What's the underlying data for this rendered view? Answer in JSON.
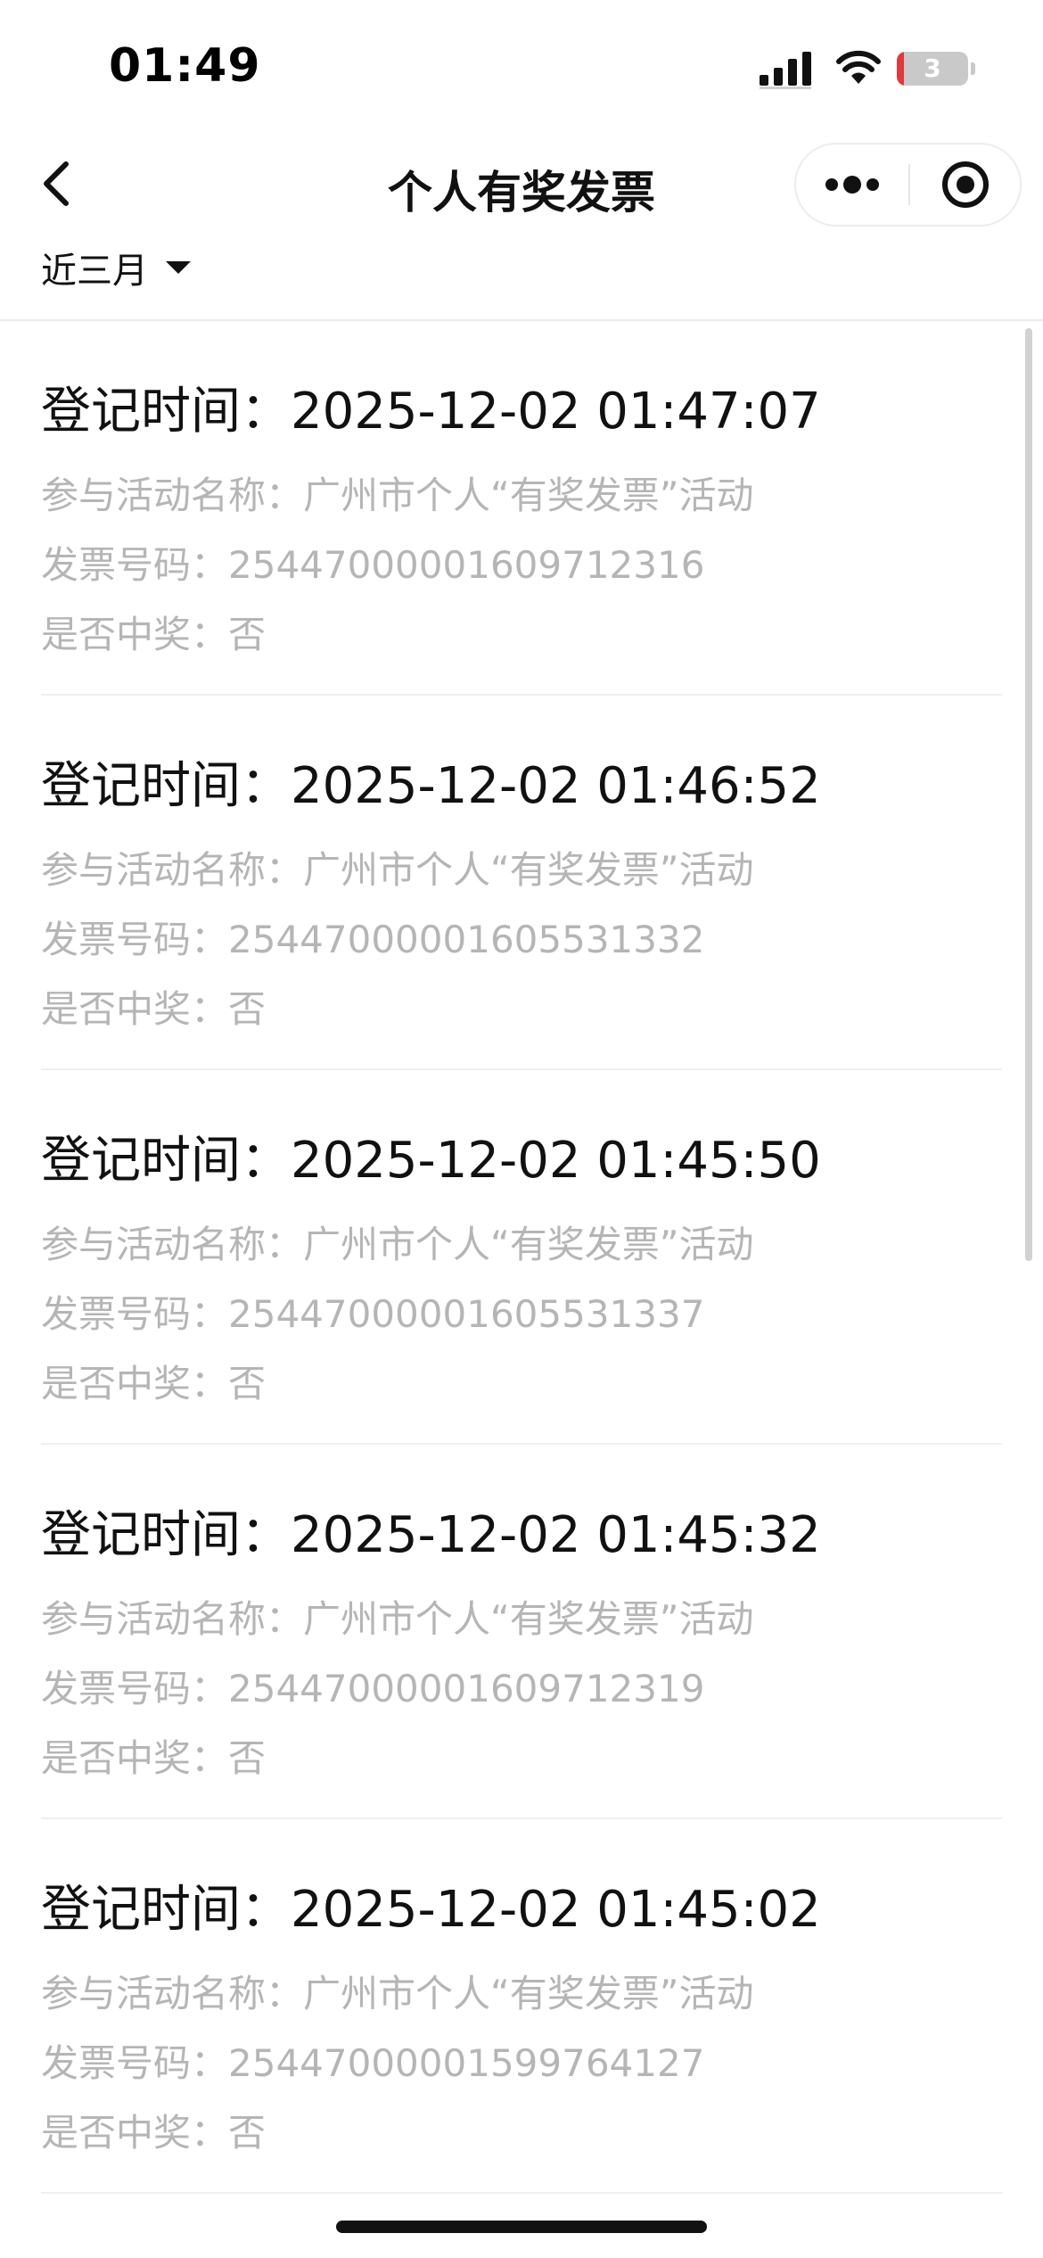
{
  "status_bar": {
    "time": "01:49",
    "battery_level": "3",
    "battery_fraction": 0.1,
    "signal_icon": "cellular-signal-icon",
    "wifi_icon": "wifi-icon",
    "battery_icon": "battery-icon"
  },
  "nav": {
    "title": "个人有奖发票",
    "back_icon": "chevron-left-icon",
    "more_icon": "more-dots-icon",
    "close_icon": "target-close-icon"
  },
  "filter": {
    "label": "近三月",
    "arrow_icon": "caret-down-icon"
  },
  "records": [
    {
      "time": "登记时间：2025-12-02 01:47:07",
      "activity": "参与活动名称：广州市个人“有奖发票”活动",
      "invoice": "发票号码：25447000001609712316",
      "prize": "是否中奖：否"
    },
    {
      "time": "登记时间：2025-12-02 01:46:52",
      "activity": "参与活动名称：广州市个人“有奖发票”活动",
      "invoice": "发票号码：25447000001605531332",
      "prize": "是否中奖：否"
    },
    {
      "time": "登记时间：2025-12-02 01:45:50",
      "activity": "参与活动名称：广州市个人“有奖发票”活动",
      "invoice": "发票号码：25447000001605531337",
      "prize": "是否中奖：否"
    },
    {
      "time": "登记时间：2025-12-02 01:45:32",
      "activity": "参与活动名称：广州市个人“有奖发票”活动",
      "invoice": "发票号码：25447000001609712319",
      "prize": "是否中奖：否"
    },
    {
      "time": "登记时间：2025-12-02 01:45:02",
      "activity": "参与活动名称：广州市个人“有奖发票”活动",
      "invoice": "发票号码：25447000001599764127",
      "prize": "是否中奖：否"
    }
  ],
  "colors": {
    "primary_text": "#111111",
    "secondary_text": "#b5b5b5",
    "divider": "#efefef",
    "battery_low": "#e0393e"
  }
}
